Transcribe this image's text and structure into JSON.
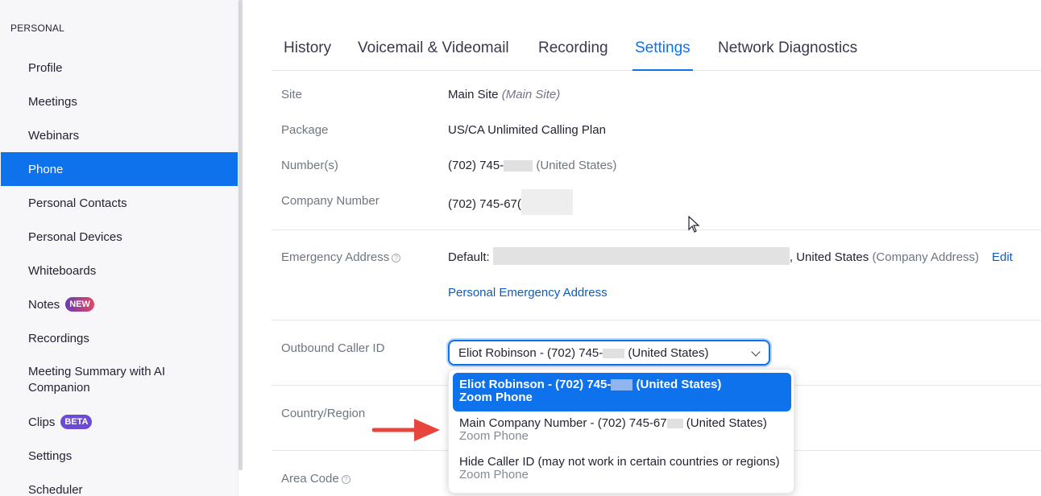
{
  "sidebar": {
    "section_title": "PERSONAL",
    "items": [
      {
        "label": "Profile"
      },
      {
        "label": "Meetings"
      },
      {
        "label": "Webinars"
      },
      {
        "label": "Phone",
        "active": true
      },
      {
        "label": "Personal Contacts"
      },
      {
        "label": "Personal Devices"
      },
      {
        "label": "Whiteboards"
      },
      {
        "label": "Notes",
        "badge": "NEW"
      },
      {
        "label": "Recordings"
      },
      {
        "label": "Meeting Summary with AI Companion"
      },
      {
        "label": "Clips",
        "badge": "BETA"
      },
      {
        "label": "Settings"
      },
      {
        "label": "Scheduler"
      }
    ]
  },
  "tabs": [
    {
      "label": "History"
    },
    {
      "label": "Voicemail & Videomail"
    },
    {
      "label": "Recording"
    },
    {
      "label": "Settings",
      "active": true
    },
    {
      "label": "Network Diagnostics"
    }
  ],
  "fields": {
    "site": {
      "label": "Site",
      "value": "Main Site",
      "note": "(Main Site)"
    },
    "package": {
      "label": "Package",
      "value": "US/CA Unlimited Calling Plan"
    },
    "numbers": {
      "label": "Number(s)",
      "value": "(702) 745-",
      "note": "(United States)"
    },
    "company_number": {
      "label": "Company Number",
      "value": "(702) 745-67("
    },
    "emergency": {
      "label": "Emergency Address",
      "prefix": "Default:",
      "country": ", United States",
      "note": "(Company Address)",
      "edit": "Edit",
      "personal_link": "Personal Emergency Address"
    },
    "outbound": {
      "label": "Outbound Caller ID",
      "selected_prefix": "Eliot Robinson - (702) 745-",
      "selected_suffix": " (United States)"
    },
    "country": {
      "label": "Country/Region"
    },
    "area_code": {
      "label": "Area Code"
    }
  },
  "dropdown": {
    "options": [
      {
        "title_prefix": "Eliot Robinson - (702) 745-",
        "title_suffix": " (United States)",
        "sub": "Zoom Phone",
        "selected": true
      },
      {
        "title_prefix": "Main Company Number - (702) 745-67",
        "title_suffix": " (United States)",
        "sub": "Zoom Phone"
      },
      {
        "title_prefix": "Hide Caller ID (may not work in certain countries or regions)",
        "title_suffix": "",
        "sub": "Zoom Phone"
      }
    ]
  },
  "colors": {
    "accent": "#0e72ed",
    "annotation_arrow": "#e8453c"
  }
}
